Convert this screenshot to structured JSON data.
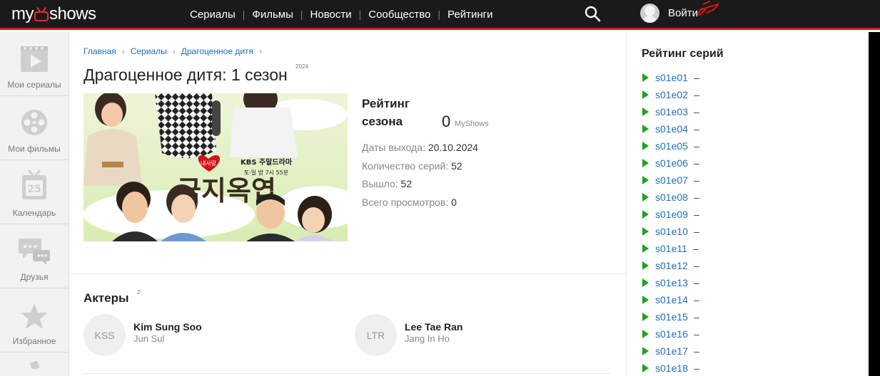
{
  "header": {
    "logo": {
      "left": "my",
      "right": "shows"
    },
    "nav": [
      "Сериалы",
      "Фильмы",
      "Новости",
      "Сообщество",
      "Рейтинги"
    ],
    "search_icon": "search-icon",
    "login_label": "Войти"
  },
  "sidebar": {
    "items": [
      {
        "label": "Мои сериалы",
        "icon": "film-play-icon"
      },
      {
        "label": "Мои фильмы",
        "icon": "film-reel-icon"
      },
      {
        "label": "Календарь",
        "icon": "calendar-icon",
        "number": "25"
      },
      {
        "label": "Друзья",
        "icon": "chat-bubbles-icon"
      },
      {
        "label": "Избранное",
        "icon": "star-icon"
      }
    ]
  },
  "breadcrumb": [
    "Главная",
    "Сериалы",
    "Драгоценное дитя"
  ],
  "page": {
    "title": "Драгоценное дитя: 1 сезон",
    "year": "2024"
  },
  "poster": {
    "badge": "KBS 주말드라마",
    "schedule": "토·일 밤 7시 55분",
    "logo_text": "금지옥엽"
  },
  "rating": {
    "title": "Рейтинг сезона",
    "value": "0",
    "source": "MyShows"
  },
  "info": [
    {
      "label": "Даты выхода:",
      "value": "20.10.2024"
    },
    {
      "label": "Количество серий:",
      "value": "52"
    },
    {
      "label": "Вышло:",
      "value": "52"
    },
    {
      "label": "Всего просмотров:",
      "value": "0"
    }
  ],
  "actors": {
    "title": "Актеры",
    "count": "2",
    "list": [
      {
        "initials": "KSS",
        "name": "Kim Sung Soo",
        "role": "Jun Sul"
      },
      {
        "initials": "LTR",
        "name": "Lee Tae Ran",
        "role": "Jang In Ho"
      }
    ]
  },
  "episode_rating": {
    "title": "Рейтинг серий",
    "episodes": [
      {
        "code": "s01e01",
        "value": "–"
      },
      {
        "code": "s01e02",
        "value": "–"
      },
      {
        "code": "s01e03",
        "value": "–"
      },
      {
        "code": "s01e04",
        "value": "–"
      },
      {
        "code": "s01e05",
        "value": "–"
      },
      {
        "code": "s01e06",
        "value": "–"
      },
      {
        "code": "s01e07",
        "value": "–"
      },
      {
        "code": "s01e08",
        "value": "–"
      },
      {
        "code": "s01e09",
        "value": "–"
      },
      {
        "code": "s01e10",
        "value": "–"
      },
      {
        "code": "s01e11",
        "value": "–"
      },
      {
        "code": "s01e12",
        "value": "–"
      },
      {
        "code": "s01e13",
        "value": "–"
      },
      {
        "code": "s01e14",
        "value": "–"
      },
      {
        "code": "s01e15",
        "value": "–"
      },
      {
        "code": "s01e16",
        "value": "–"
      },
      {
        "code": "s01e17",
        "value": "–"
      },
      {
        "code": "s01e18",
        "value": "–"
      }
    ]
  },
  "colors": {
    "header_bg": "#1a1a1a",
    "accent_red": "#c81e1e",
    "link_blue": "#1f6fb5",
    "play_green": "#22a122"
  }
}
